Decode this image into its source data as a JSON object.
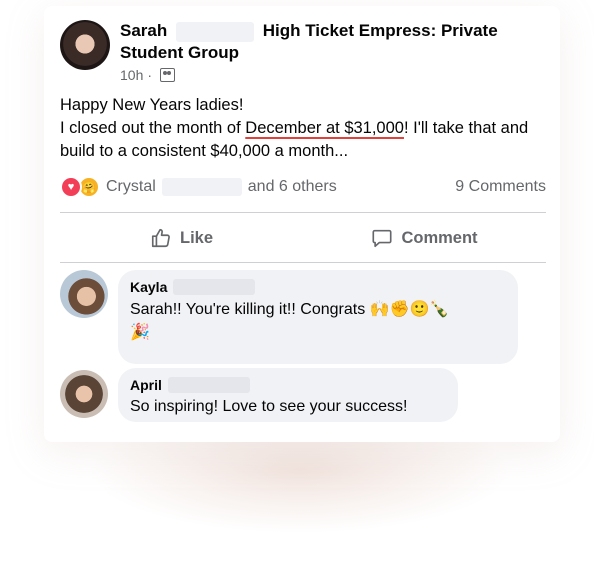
{
  "post": {
    "author_first": "Sarah",
    "group_name": "High Ticket Empress: Private Student Group",
    "time": "10h",
    "separator": "·",
    "text_line1": "Happy New Years ladies!",
    "text_line2_pre": "I closed out the month of ",
    "text_line2_highlight": "December at $31,000",
    "text_line2_post": "! I'll take that and build to a consistent $40,000 a month...",
    "reaction_name": "Crystal",
    "reaction_others": "and 6 others",
    "comments_count": "9 Comments",
    "like_label": "Like",
    "comment_label": "Comment"
  },
  "comments": [
    {
      "author": "Kayla",
      "text": "Sarah!! You're killing it!! Congrats",
      "emojis": "🙌✊🙂🍾",
      "emoji_line2": "🎉"
    },
    {
      "author": "April",
      "text": "So inspiring! Love to see your success!"
    }
  ],
  "icons": {
    "love": "heart-reaction",
    "care": "care-reaction",
    "like": "thumbs-up-icon",
    "comment": "speech-bubble-icon",
    "audience": "group-icon"
  },
  "colors": {
    "underline": "#e0413d",
    "love": "#f33e58",
    "care": "#f7b125",
    "secondary_text": "#65676b",
    "bubble": "#f0f2f5"
  }
}
